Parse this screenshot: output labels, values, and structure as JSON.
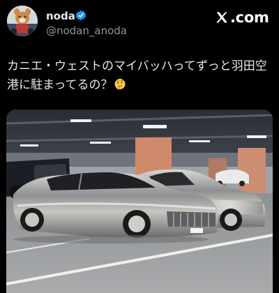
{
  "tweet": {
    "author": {
      "display_name": "noda",
      "handle": "@nodan_anoda",
      "verified": true,
      "avatar_icon": "avatar-character-icon"
    },
    "brand": {
      "label": ".com",
      "logo_icon": "x-logo-icon"
    },
    "text_line1": "カニエ・ウェストのマイバッハってずっと羽田空",
    "text_line2": "港に駐まってるの？",
    "emoji": "thinking-face-icon",
    "media": {
      "type": "photo",
      "description_icon": "parking-garage-photo"
    }
  },
  "colors": {
    "background": "#000000",
    "text_primary": "#e7e9ea",
    "text_secondary": "#8b98a5",
    "verified_badge": "#1d9bf0"
  }
}
